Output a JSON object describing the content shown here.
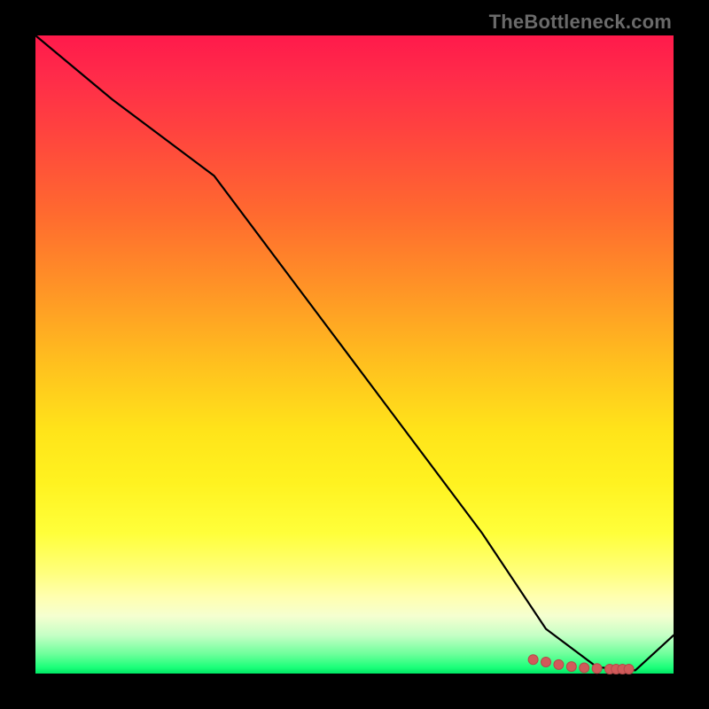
{
  "watermark": "TheBottleneck.com",
  "colors": {
    "background": "#000000",
    "curve": "#000000",
    "marker": "#d15a5a"
  },
  "chart_data": {
    "type": "line",
    "title": "",
    "xlabel": "",
    "ylabel": "",
    "xlim": [
      0,
      100
    ],
    "ylim": [
      0,
      100
    ],
    "grid": false,
    "legend": false,
    "series": [
      {
        "name": "curve",
        "x": [
          0,
          12,
          28,
          40,
          55,
          70,
          80,
          88,
          94,
          100
        ],
        "y": [
          100,
          90,
          78,
          62,
          42,
          22,
          7,
          1,
          0.5,
          6
        ]
      }
    ],
    "marker_cluster": {
      "x": [
        78,
        80,
        82,
        84,
        86,
        88,
        90,
        91,
        92,
        93
      ],
      "y": [
        2.2,
        1.8,
        1.4,
        1.1,
        0.9,
        0.8,
        0.7,
        0.7,
        0.7,
        0.7
      ]
    }
  }
}
